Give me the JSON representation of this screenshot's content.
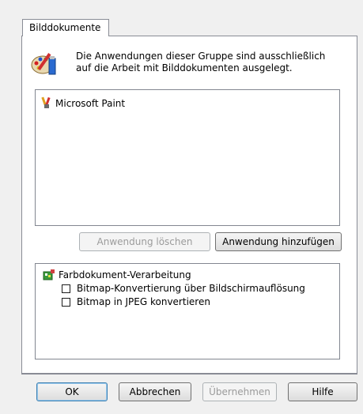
{
  "tab": {
    "label": "Bilddokumente"
  },
  "header": {
    "icon": "paint-palette-icon",
    "description_line1": "Die Anwendungen dieser Gruppe sind ausschließlich",
    "description_line2": "auf die Arbeit mit Bilddokumenten ausgelegt."
  },
  "app_list": {
    "items": [
      {
        "icon": "paintbrush-icon",
        "label": "Microsoft Paint"
      }
    ]
  },
  "app_buttons": {
    "remove_label": "Anwendung löschen",
    "add_label": "Anwendung hinzufügen"
  },
  "options": {
    "group_icon": "color-document-icon",
    "group_label": "Farbdokument-Verarbeitung",
    "items": [
      {
        "label": "Bitmap-Konvertierung über Bildschirmauflösung",
        "checked": false
      },
      {
        "label": "Bitmap in JPEG konvertieren",
        "checked": false
      }
    ]
  },
  "footer": {
    "ok_label": "OK",
    "cancel_label": "Abbrechen",
    "apply_label": "Übernehmen",
    "help_label": "Hilfe"
  }
}
